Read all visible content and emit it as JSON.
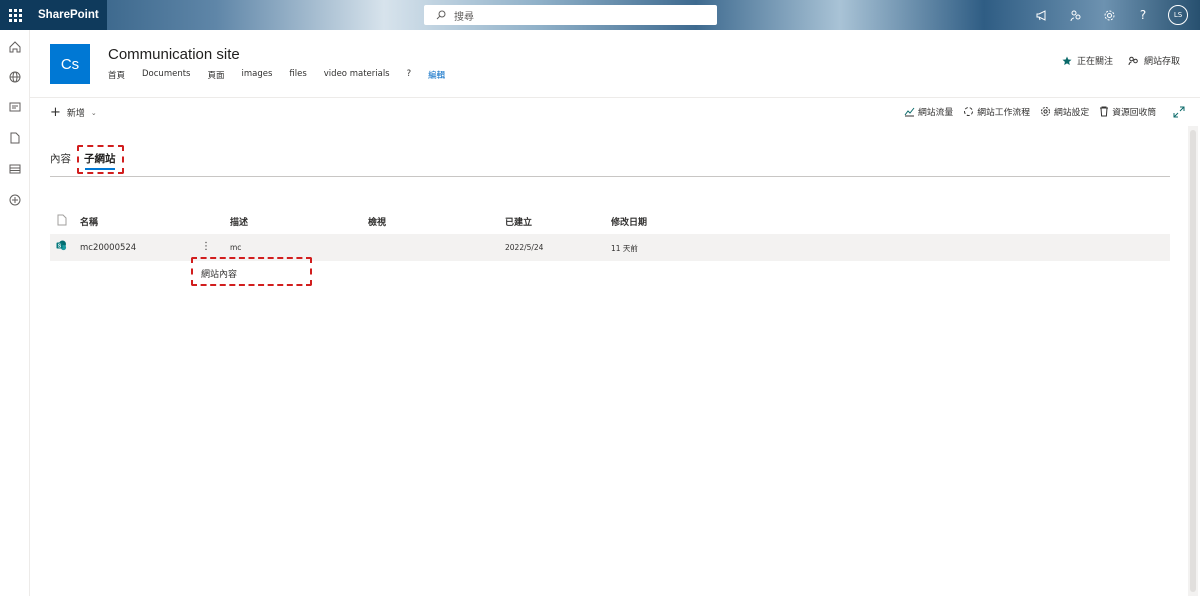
{
  "suite": {
    "brand": "SharePoint",
    "search_placeholder": "搜尋",
    "avatar_initials": "LS"
  },
  "site": {
    "logo_text": "Cs",
    "title": "Communication site",
    "nav": [
      "首頁",
      "Documents",
      "頁面",
      "images",
      "files",
      "video materials",
      "?",
      "編輯"
    ],
    "follow_label": "正在關注",
    "site_access_label": "網站存取"
  },
  "command": {
    "new_label": "新增",
    "site_usage": "網站流量",
    "site_workflows": "網站工作流程",
    "site_settings": "網站設定",
    "recycle_bin": "資源回收筒"
  },
  "pivot": {
    "tab_contents": "內容",
    "tab_subsites": "子網站"
  },
  "table": {
    "headers": {
      "name": "名稱",
      "description": "描述",
      "views": "檢視",
      "created": "已建立",
      "modified": "修改日期"
    },
    "rows": [
      {
        "name": "mc20000524",
        "description": "mc",
        "views": "",
        "created": "2022/5/24",
        "modified": "11 天前"
      }
    ],
    "context_menu_item": "網站內容"
  },
  "colors": {
    "accent": "#0078d4",
    "highlight": "#d11e1e"
  }
}
